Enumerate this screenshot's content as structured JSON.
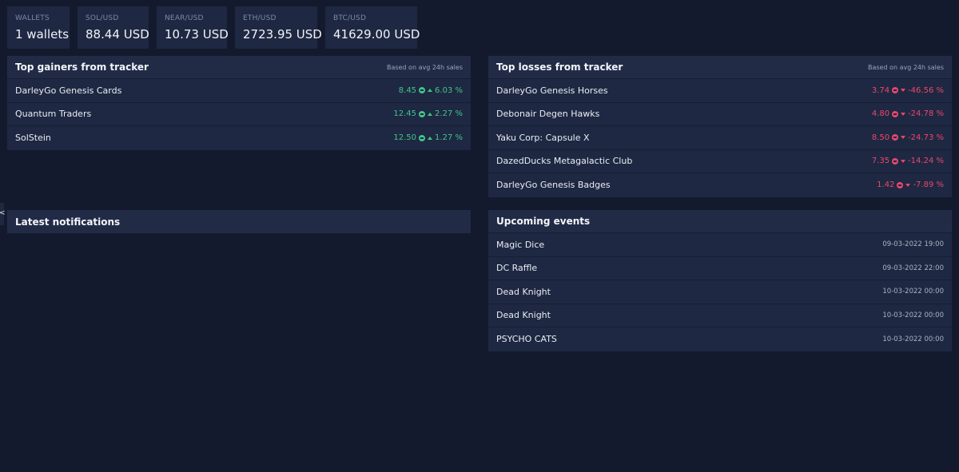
{
  "stats": [
    {
      "label": "WALLETS",
      "value": "1 wallets"
    },
    {
      "label": "SOL/USD",
      "value": "88.44 USD"
    },
    {
      "label": "NEAR/USD",
      "value": "10.73 USD"
    },
    {
      "label": "ETH/USD",
      "value": "2723.95 USD"
    },
    {
      "label": "BTC/USD",
      "value": "41629.00 USD"
    }
  ],
  "gainers": {
    "title": "Top gainers from tracker",
    "note": "Based on avg 24h sales",
    "rows": [
      {
        "name": "DarleyGo Genesis Cards",
        "price": "8.45",
        "change": "6.03 %"
      },
      {
        "name": "Quantum Traders",
        "price": "12.45",
        "change": "2.27 %"
      },
      {
        "name": "SolStein",
        "price": "12.50",
        "change": "1.27 %"
      }
    ]
  },
  "losses": {
    "title": "Top losses from tracker",
    "note": "Based on avg 24h sales",
    "rows": [
      {
        "name": "DarleyGo Genesis Horses",
        "price": "3.74",
        "change": "-46.56 %"
      },
      {
        "name": "Debonair Degen Hawks",
        "price": "4.80",
        "change": "-24.78 %"
      },
      {
        "name": "Yaku Corp: Capsule X",
        "price": "8.50",
        "change": "-24.73 %"
      },
      {
        "name": "DazedDucks Metagalactic Club",
        "price": "7.35",
        "change": "-14.24 %"
      },
      {
        "name": "DarleyGo Genesis Badges",
        "price": "1.42",
        "change": "-7.89 %"
      }
    ]
  },
  "notifications": {
    "title": "Latest notifications"
  },
  "events": {
    "title": "Upcoming events",
    "rows": [
      {
        "name": "Magic Dice",
        "date": "09-03-2022 19:00"
      },
      {
        "name": "DC Raffle",
        "date": "09-03-2022 22:00"
      },
      {
        "name": "Dead Knight",
        "date": "10-03-2022 00:00"
      },
      {
        "name": "Dead Knight",
        "date": "10-03-2022 00:00"
      },
      {
        "name": "PSYCHO CATS",
        "date": "10-03-2022 00:00"
      }
    ]
  },
  "edge_tab": {
    "glyph": "<"
  },
  "colors": {
    "background": "#141a2e",
    "panel": "#1f2842",
    "gain": "#3fc58a",
    "loss": "#e8476b"
  }
}
